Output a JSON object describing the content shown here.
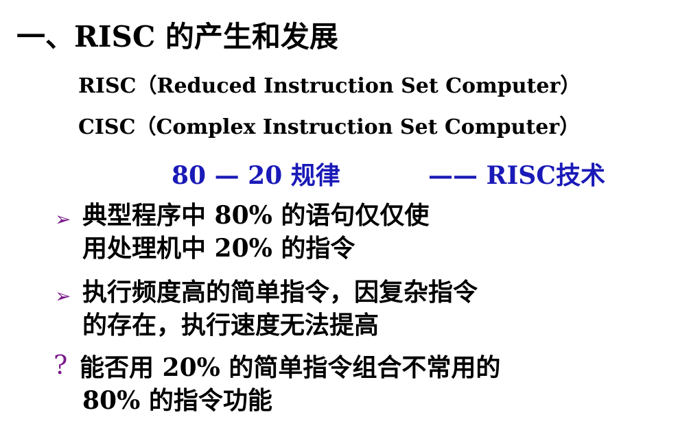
{
  "slide": {
    "title": "一、RISC 的产生和发展",
    "definitions": [
      "RISC（Reduced Instruction Set Computer）",
      "CISC（Complex Instruction Set Computer）"
    ],
    "rule_left": "80 — 20 规律",
    "rule_right": "—— RISC技术",
    "bullet_marker": "➢",
    "question_marker": "?",
    "points": [
      {
        "line1": "典型程序中 80% 的语句仅仅使",
        "line2": "用处理机中 20% 的指令"
      },
      {
        "line1": "执行频度高的简单指令，因复杂指令",
        "line2": "的存在，执行速度无法提高"
      }
    ],
    "question": {
      "line1": "能否用 20% 的简单指令组合不常用的",
      "line2": "80% 的指令功能"
    },
    "colors": {
      "accent_blue": "#1a1ab8",
      "bullet_purple": "#7a1a8a",
      "text": "#000000"
    }
  }
}
